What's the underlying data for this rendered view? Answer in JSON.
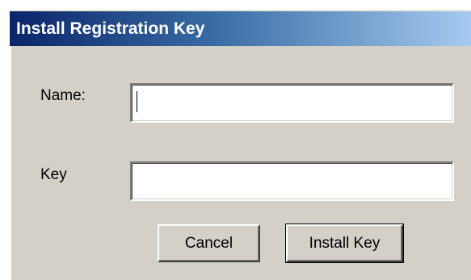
{
  "dialog": {
    "title": "Install Registration Key",
    "name_label": "Name:",
    "name_value": "",
    "key_label": "Key",
    "key_value": "",
    "cancel_label": "Cancel",
    "install_label": "Install Key"
  },
  "colors": {
    "title_start": "#0a246a",
    "title_end": "#a6caf0",
    "face": "#d4d0c8"
  }
}
